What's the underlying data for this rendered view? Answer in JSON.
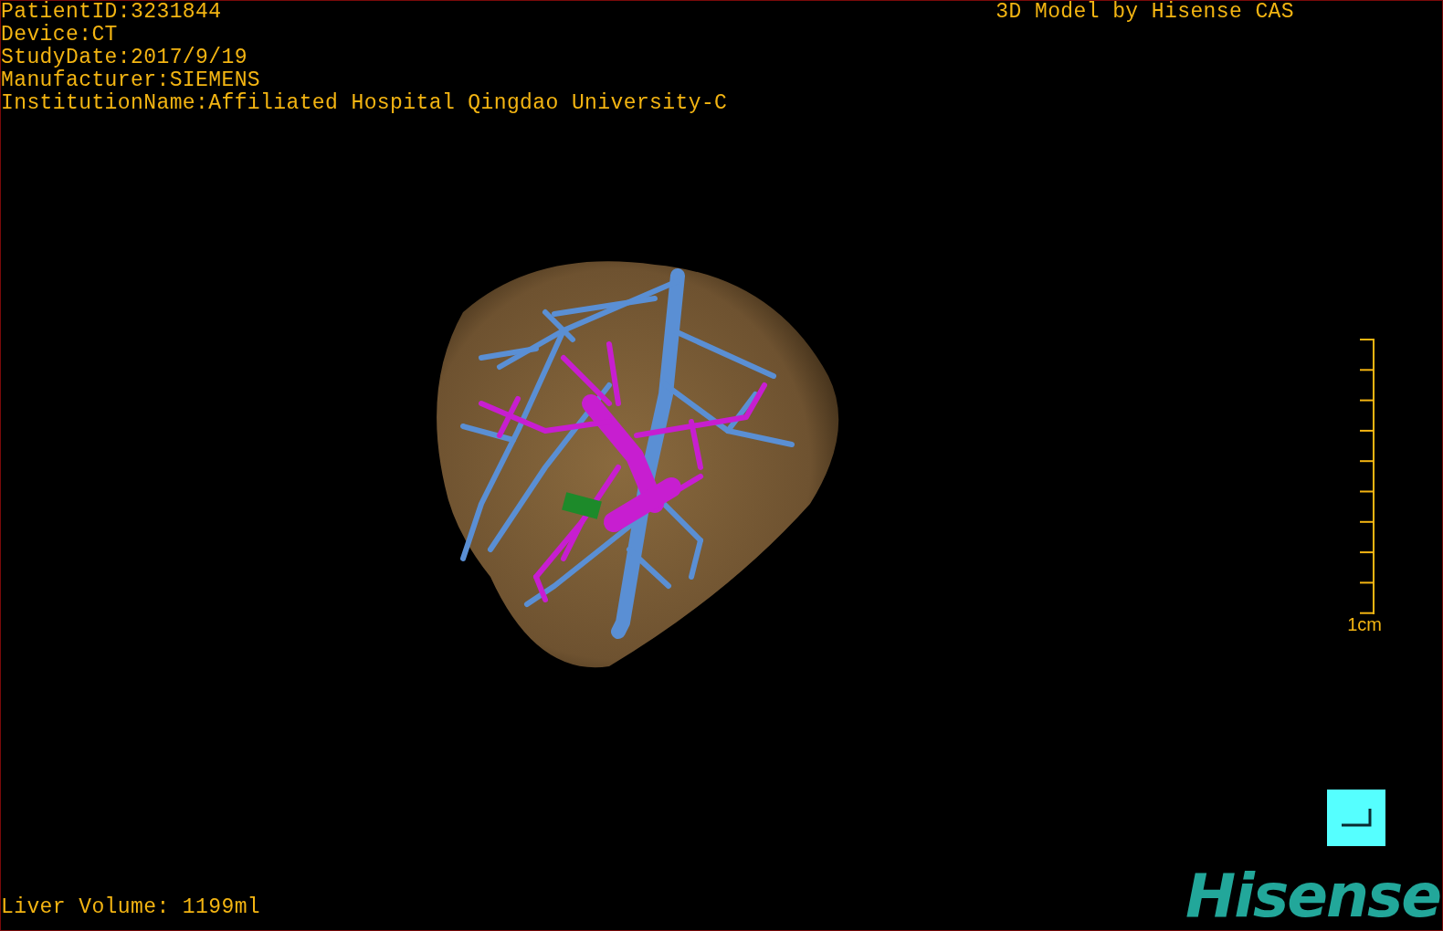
{
  "study_info": [
    "PatientID:3231844",
    "Device:CT",
    "StudyDate:2017/9/19",
    "Manufacturer:SIEMENS",
    "InstitutionName:Affiliated Hospital Qingdao University-C"
  ],
  "model_credit": "3D Model by Hisense CAS",
  "scale_bar": {
    "label": "1cm"
  },
  "liver_volume": "Liver Volume: 1199ml",
  "logo": "Hisense"
}
